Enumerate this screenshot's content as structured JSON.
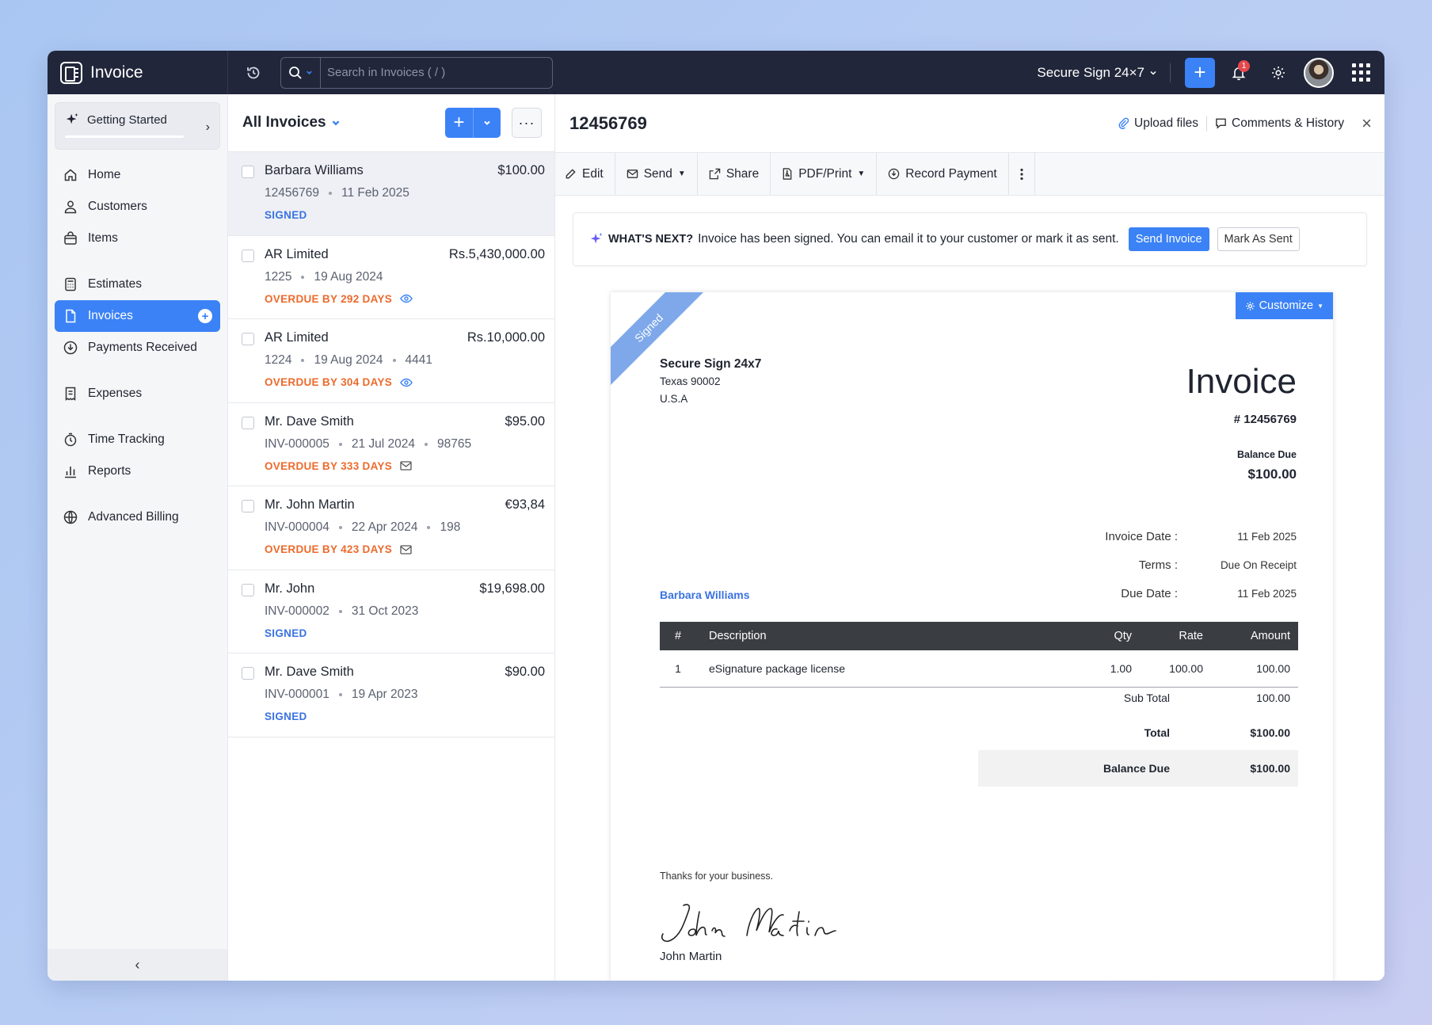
{
  "app": {
    "name": "Invoice"
  },
  "search": {
    "placeholder": "Search in Invoices ( / )"
  },
  "org": {
    "name": "Secure Sign 24×7"
  },
  "notifications": {
    "count": "1"
  },
  "sidebar": {
    "getting_started": "Getting Started",
    "items": [
      {
        "label": "Home",
        "icon": "home-icon"
      },
      {
        "label": "Customers",
        "icon": "user-icon"
      },
      {
        "label": "Items",
        "icon": "bag-icon"
      },
      {
        "label": "Estimates",
        "icon": "calculator-icon"
      },
      {
        "label": "Invoices",
        "icon": "document-icon",
        "active": true
      },
      {
        "label": "Payments Received",
        "icon": "download-circle-icon"
      },
      {
        "label": "Expenses",
        "icon": "receipt-icon"
      },
      {
        "label": "Time Tracking",
        "icon": "stopwatch-icon"
      },
      {
        "label": "Reports",
        "icon": "bar-chart-icon"
      },
      {
        "label": "Advanced Billing",
        "icon": "globe-icon"
      }
    ]
  },
  "list": {
    "title": "All Invoices",
    "rows": [
      {
        "name": "Barbara Williams",
        "amount": "$100.00",
        "number": "12456769",
        "date": "11 Feb 2025",
        "ref": "",
        "status": "SIGNED",
        "status_type": "signed",
        "status_icon": ""
      },
      {
        "name": "AR Limited",
        "amount": "Rs.5,430,000.00",
        "number": "1225",
        "date": "19 Aug 2024",
        "ref": "",
        "status": "OVERDUE BY 292 DAYS",
        "status_type": "overdue",
        "status_icon": "eye-icon"
      },
      {
        "name": "AR Limited",
        "amount": "Rs.10,000.00",
        "number": "1224",
        "date": "19 Aug 2024",
        "ref": "4441",
        "status": "OVERDUE BY 304 DAYS",
        "status_type": "overdue",
        "status_icon": "eye-icon"
      },
      {
        "name": "Mr. Dave Smith",
        "amount": "$95.00",
        "number": "INV-000005",
        "date": "21 Jul 2024",
        "ref": "98765",
        "status": "OVERDUE BY 333 DAYS",
        "status_type": "overdue",
        "status_icon": "mail-icon"
      },
      {
        "name": "Mr. John Martin",
        "amount": "€93,84",
        "number": "INV-000004",
        "date": "22 Apr 2024",
        "ref": "198",
        "status": "OVERDUE BY 423 DAYS",
        "status_type": "overdue",
        "status_icon": "mail-icon"
      },
      {
        "name": "Mr. John",
        "amount": "$19,698.00",
        "number": "INV-000002",
        "date": "31 Oct 2023",
        "ref": "",
        "status": "SIGNED",
        "status_type": "signed",
        "status_icon": ""
      },
      {
        "name": "Mr. Dave Smith",
        "amount": "$90.00",
        "number": "INV-000001",
        "date": "19 Apr 2023",
        "ref": "",
        "status": "SIGNED",
        "status_type": "signed",
        "status_icon": ""
      }
    ]
  },
  "detail": {
    "title": "12456769",
    "upload": "Upload files",
    "comments": "Comments & History",
    "toolbar": {
      "edit": "Edit",
      "send": "Send",
      "share": "Share",
      "pdf": "PDF/Print",
      "record": "Record Payment"
    },
    "next": {
      "label": "WHAT'S NEXT?",
      "text": "Invoice has been signed. You can email it to your customer or mark it as sent.",
      "send_btn": "Send Invoice",
      "mark_btn": "Mark As Sent"
    }
  },
  "invoice": {
    "ribbon": "Signed",
    "customize": "Customize",
    "from": {
      "company": "Secure Sign 24x7",
      "line1": "Texas 90002",
      "line2": "U.S.A"
    },
    "title": "Invoice",
    "number": "# 12456769",
    "balance_label": "Balance Due",
    "balance": "$100.00",
    "meta": [
      {
        "k": "Invoice Date :",
        "v": "11 Feb 2025"
      },
      {
        "k": "Terms :",
        "v": "Due On Receipt"
      },
      {
        "k": "Due Date :",
        "v": "11 Feb 2025"
      }
    ],
    "bill_to": "Barbara Williams",
    "headers": {
      "num": "#",
      "desc": "Description",
      "qty": "Qty",
      "rate": "Rate",
      "amount": "Amount"
    },
    "lines": [
      {
        "num": "1",
        "desc": "eSignature package license",
        "qty": "1.00",
        "rate": "100.00",
        "amount": "100.00"
      }
    ],
    "totals": {
      "subtotal_label": "Sub Total",
      "subtotal": "100.00",
      "total_label": "Total",
      "total": "$100.00",
      "balance_label": "Balance Due",
      "balance": "$100.00"
    },
    "thanks": "Thanks for your business.",
    "signature_name": "John Martin"
  },
  "colors": {
    "accent": "#3b82f6",
    "overdue": "#ec6a2c",
    "signed": "#3b73e0",
    "topbar": "#21263a"
  }
}
